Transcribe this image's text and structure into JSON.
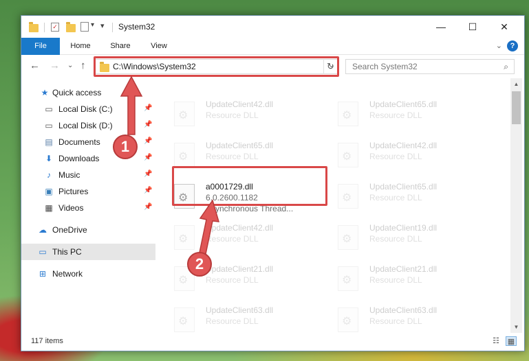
{
  "window": {
    "title": "System32",
    "minimize_glyph": "—",
    "maximize_glyph": "☐",
    "close_glyph": "✕",
    "qat_glyph": "▾"
  },
  "ribbon": {
    "tabs": [
      "File",
      "Home",
      "Share",
      "View"
    ],
    "collapse_glyph": "⌄",
    "help_glyph": "?"
  },
  "nav": {
    "back_glyph": "←",
    "forward_glyph": "→",
    "recent_glyph": "⌄",
    "up_glyph": "↑"
  },
  "address": {
    "path": "C:\\Windows\\System32",
    "dropdown_glyph": "⌄",
    "refresh_glyph": "↻"
  },
  "search": {
    "placeholder": "Search System32",
    "icon_glyph": "⌕"
  },
  "sidebar": {
    "items": [
      {
        "label": "Quick access",
        "icon": "star-icon",
        "glyph": "★",
        "color": "#2a7ad0"
      },
      {
        "label": "Local Disk (C:)",
        "icon": "drive-icon",
        "glyph": "▭",
        "color": "#555555"
      },
      {
        "label": "Local Disk (D:)",
        "icon": "drive-icon",
        "glyph": "▭",
        "color": "#555555"
      },
      {
        "label": "Documents",
        "icon": "documents-icon",
        "glyph": "▤",
        "color": "#5a7fa8"
      },
      {
        "label": "Downloads",
        "icon": "downloads-icon",
        "glyph": "⬇",
        "color": "#2a7ad0"
      },
      {
        "label": "Music",
        "icon": "music-icon",
        "glyph": "♪",
        "color": "#2a7ad0"
      },
      {
        "label": "Pictures",
        "icon": "pictures-icon",
        "glyph": "▣",
        "color": "#3a7fb8"
      },
      {
        "label": "Videos",
        "icon": "videos-icon",
        "glyph": "▦",
        "color": "#444444"
      },
      {
        "label": "OneDrive",
        "icon": "cloud-icon",
        "glyph": "☁",
        "color": "#2a7ad0"
      },
      {
        "label": "This PC",
        "icon": "computer-icon",
        "glyph": "▭",
        "color": "#2a7ad0"
      },
      {
        "label": "Network",
        "icon": "network-icon",
        "glyph": "⊞",
        "color": "#2a7ad0"
      }
    ],
    "pin_glyph": "📌"
  },
  "files": [
    {
      "name": "UpdateClient42.dll",
      "line2": "Resource DLL",
      "line3": ""
    },
    {
      "name": "UpdateClient65.dll",
      "line2": "Resource DLL",
      "line3": ""
    },
    {
      "name": "UpdateClient65.dll",
      "line2": "Resource DLL",
      "line3": ""
    },
    {
      "name": "UpdateClient42.dll",
      "line2": "Resource DLL",
      "line3": ""
    },
    {
      "name": "a0001729.dll",
      "line2": "6.0.2600.1182",
      "line3": "Asynchronous Thread..."
    },
    {
      "name": "UpdateClient65.dll",
      "line2": "Resource DLL",
      "line3": ""
    },
    {
      "name": "UpdateClient42.dll",
      "line2": "Resource DLL",
      "line3": ""
    },
    {
      "name": "UpdateClient19.dll",
      "line2": "Resource DLL",
      "line3": ""
    },
    {
      "name": "UpdateClient21.dll",
      "line2": "Resource DLL",
      "line3": ""
    },
    {
      "name": "UpdateClient21.dll",
      "line2": "Resource DLL",
      "line3": ""
    },
    {
      "name": "UpdateClient63.dll",
      "line2": "Resource DLL",
      "line3": ""
    },
    {
      "name": "UpdateClient63.dll",
      "line2": "Resource DLL",
      "line3": ""
    }
  ],
  "scroll": {
    "up_glyph": "▲",
    "down_glyph": "▼"
  },
  "status": {
    "item_count": "117 items",
    "details_view_glyph": "☷",
    "tiles_view_glyph": "▦"
  },
  "annotations": {
    "marker1": "1",
    "marker2": "2",
    "highlight_color": "#d94848"
  }
}
